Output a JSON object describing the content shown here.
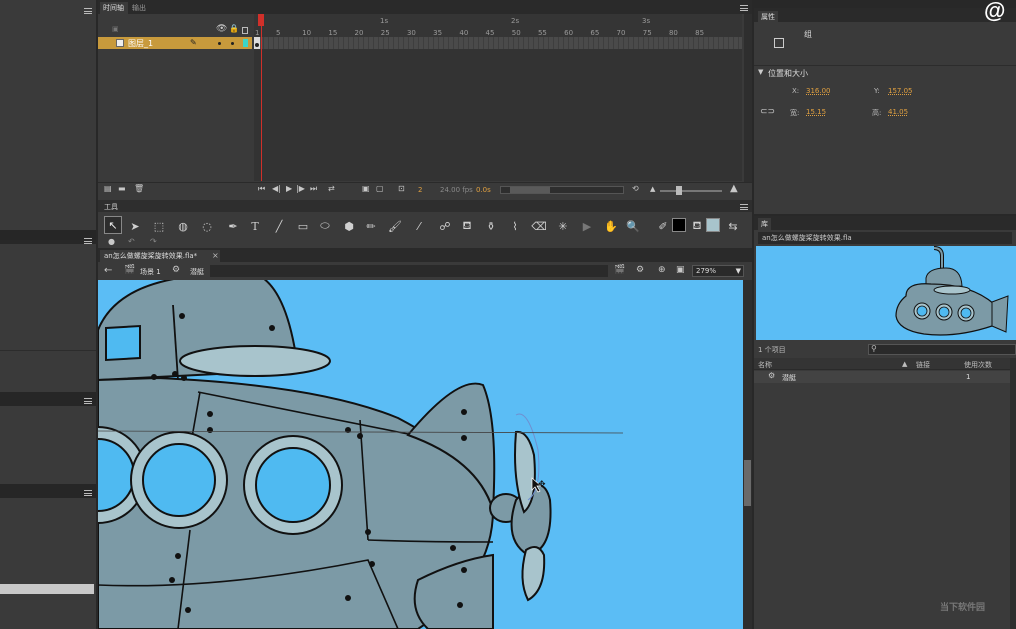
{
  "timeline": {
    "tab_timeline": "时间轴",
    "tab_output": "输出",
    "layer_name": "图层_1",
    "seconds": [
      "1s",
      "2s",
      "3s"
    ],
    "frame_ticks": [
      "1",
      "5",
      "10",
      "15",
      "20",
      "25",
      "30",
      "35",
      "40",
      "45",
      "50",
      "55",
      "60",
      "65",
      "70",
      "75",
      "80",
      "85"
    ],
    "current_frame": "2",
    "fps": "24.00 fps",
    "elapsed": "0.0s"
  },
  "properties": {
    "title": "属性",
    "group_label": "组",
    "section_title": "位置和大小",
    "x_label": "X:",
    "x_value": "316.00",
    "y_label": "Y:",
    "y_value": "157.05",
    "w_label": "宽:",
    "w_value": "15.15",
    "h_label": "高:",
    "h_value": "41.05"
  },
  "tools": {
    "title": "工具"
  },
  "document": {
    "tab_name": "an怎么做螺旋桨旋转效果.fla*",
    "scene": "场景 1",
    "symbol": "潜艇",
    "zoom": "279%"
  },
  "library": {
    "title": "库",
    "file": "an怎么做螺旋桨旋转效果.fla",
    "count": "1 个项目",
    "col_name": "名称",
    "col_link": "链接",
    "col_use": "使用次数",
    "item_name": "潜艇",
    "item_use": "1"
  },
  "watermark": {
    "at": "@",
    "site": "当下软件园"
  },
  "colors": {
    "stage_bg": "#5bbdf5",
    "hull": "#7c9aa6",
    "hull_light": "#9fb5bf",
    "window": "#4fbaf1",
    "ring": "#a8c4cc",
    "accent": "#e0a040",
    "playhead": "#d0302a"
  }
}
